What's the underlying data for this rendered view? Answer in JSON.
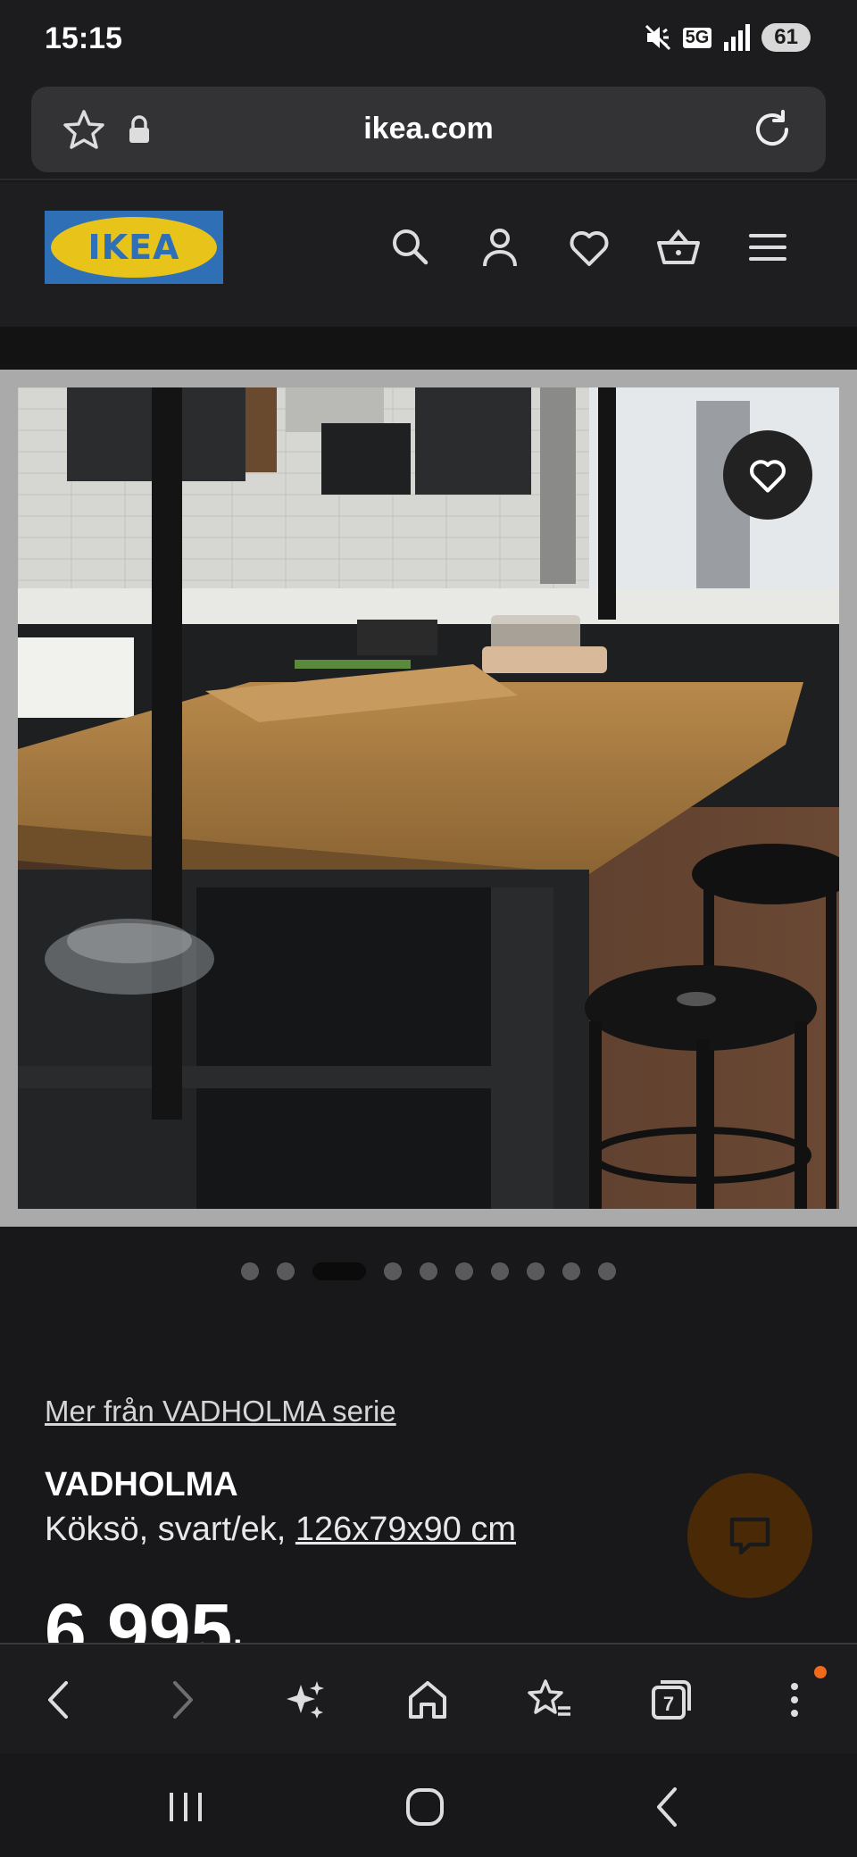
{
  "status_bar": {
    "time": "15:15",
    "network": "5G",
    "battery": "61"
  },
  "browser": {
    "url": "ikea.com",
    "tab_count": "7"
  },
  "site": {
    "logo_text": "IKEA",
    "colors": {
      "logo_blue": "#2e6fb5",
      "logo_yellow": "#e8c41a",
      "chat_button": "#4a2a06"
    },
    "header_icons": [
      "search-icon",
      "account-icon",
      "heart-icon",
      "basket-icon",
      "menu-icon"
    ]
  },
  "gallery": {
    "slide_count": 10,
    "active_index": 2
  },
  "product": {
    "series_link": "Mer från VADHOLMA serie",
    "name": "VADHOLMA",
    "description_prefix": "Köksö, svart/ek, ",
    "dimensions": "126x79x90 cm",
    "price": "6 995",
    "price_suffix": ":-"
  }
}
